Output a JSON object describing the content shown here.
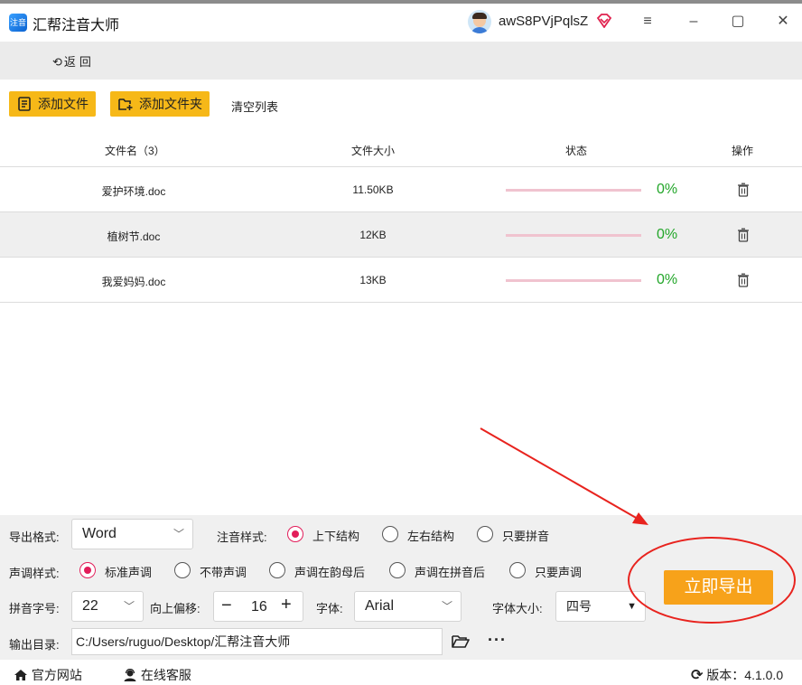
{
  "app": {
    "title": "汇帮注音大师",
    "logo_text": "注音",
    "username": "awS8PVjPqlsZ"
  },
  "window_controls": {
    "menu": "≡",
    "minimize": "–",
    "maximize": "▢",
    "close": "✕"
  },
  "nav": {
    "back_label": "返回"
  },
  "toolbar": {
    "add_file": "添加文件",
    "add_folder": "添加文件夹",
    "clear_list": "清空列表"
  },
  "table": {
    "headers": {
      "name": "文件名（3）",
      "size": "文件大小",
      "status": "状态",
      "action": "操作"
    },
    "rows": [
      {
        "name": "爱护环境.doc",
        "size": "11.50KB",
        "progress": "0%"
      },
      {
        "name": "植树节.doc",
        "size": "12KB",
        "progress": "0%"
      },
      {
        "name": "我爱妈妈.doc",
        "size": "13KB",
        "progress": "0%"
      }
    ]
  },
  "settings": {
    "export_format": {
      "label": "导出格式:",
      "value": "Word"
    },
    "annotation_style": {
      "label": "注音样式:",
      "options": [
        "上下结构",
        "左右结构",
        "只要拼音"
      ],
      "selected": "上下结构"
    },
    "tone_style": {
      "label": "声调样式:",
      "options": [
        "标准声调",
        "不带声调",
        "声调在韵母后",
        "声调在拼音后",
        "只要声调"
      ],
      "selected": "标准声调"
    },
    "pinyin_size": {
      "label": "拼音字号:",
      "value": "22"
    },
    "offset": {
      "label": "向上偏移:",
      "value": "16",
      "minus": "−",
      "plus": "+"
    },
    "font": {
      "label": "字体:",
      "value": "Arial"
    },
    "font_size": {
      "label": "字体大小:",
      "value": "四号"
    },
    "output_dir": {
      "label": "输出目录:",
      "value": "C:/Users/ruguo/Desktop/汇帮注音大师",
      "more": "···"
    },
    "export_button": "立即导出"
  },
  "footer": {
    "website": "官方网站",
    "support": "在线客服",
    "version": "版本：4.1.0.0"
  },
  "colors": {
    "accent_yellow": "#f6b818",
    "export_orange": "#f7a21a",
    "radio_pink": "#e21d5a",
    "progress_green": "#22a629",
    "annotation_red": "#e8231e"
  }
}
